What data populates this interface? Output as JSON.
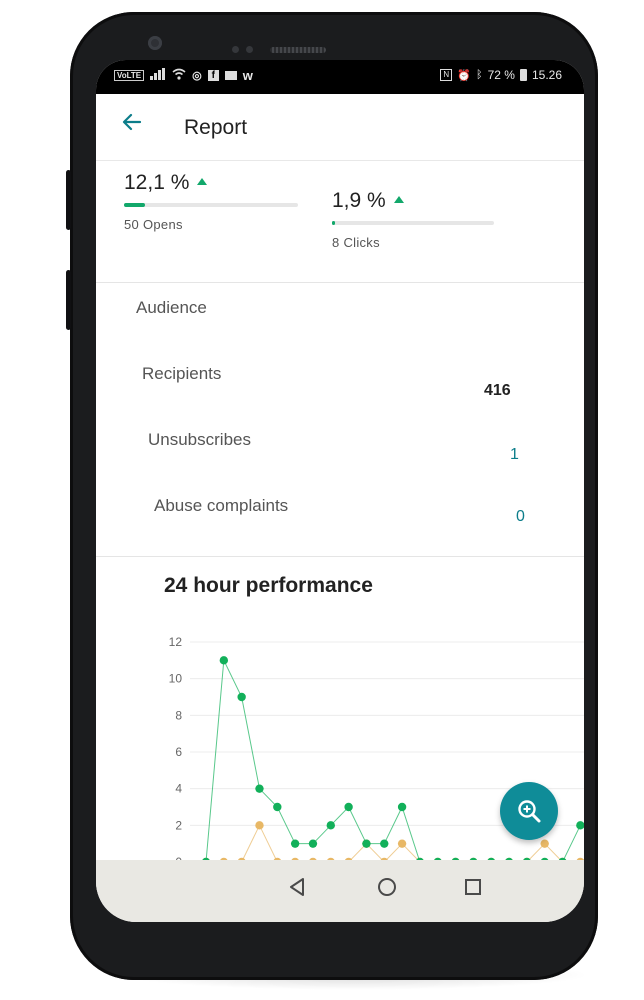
{
  "status_bar": {
    "left_icons": [
      "volte-icon",
      "signal-icon",
      "wifi-icon",
      "camera-notif-icon",
      "facebook-icon",
      "mail-icon",
      "w-icon"
    ],
    "volte": "VoLTE",
    "battery": "72 %",
    "time": "15.26"
  },
  "app_bar": {
    "title": "Report",
    "back_icon": "arrow-left-icon"
  },
  "stats": [
    {
      "value": "12,1 %",
      "trend": "up",
      "progress": 0.12,
      "label": "50 Opens"
    },
    {
      "value": "1,9 %",
      "trend": "up",
      "progress": 0.02,
      "label": "8 Clicks"
    }
  ],
  "audience": {
    "heading": "Audience",
    "rows": [
      {
        "label": "Recipients",
        "value": "416"
      },
      {
        "label": "Unsubscribes",
        "value": "1"
      },
      {
        "label": "Abuse complaints",
        "value": "0"
      }
    ]
  },
  "performance": {
    "title": "24 hour performance"
  },
  "colors": {
    "accent": "#0f8c98",
    "opens_series": "#12b05a",
    "clicks_series": "#e8b866",
    "trend_up": "#12a86b"
  },
  "chart_data": {
    "type": "line",
    "title": "24 hour performance",
    "ylim": [
      0,
      12
    ],
    "yticks": [
      "0",
      "2",
      "4",
      "6",
      "8",
      "10",
      "12"
    ],
    "grid": true,
    "x": [
      0,
      1,
      2,
      3,
      4,
      5,
      6,
      7,
      8,
      9,
      10,
      11,
      12,
      13,
      14,
      15,
      16,
      17,
      18,
      19,
      20,
      21,
      22,
      23
    ],
    "series": [
      {
        "color": "#12b05a",
        "values": [
          0,
          11,
          9,
          4,
          3,
          1,
          1,
          2,
          3,
          1,
          1,
          3,
          0,
          0,
          0,
          0,
          0,
          0,
          0,
          0,
          0,
          2,
          2,
          0
        ]
      },
      {
        "color": "#e8b866",
        "values": [
          0,
          0,
          0,
          2,
          0,
          0,
          0,
          0,
          0,
          1,
          0,
          1,
          0,
          0,
          0,
          0,
          0,
          0,
          0,
          1,
          0,
          0,
          0,
          0
        ]
      }
    ]
  },
  "fab": {
    "icon": "zoom-in-icon"
  },
  "nav": {
    "icons": [
      "back-triangle-icon",
      "home-circle-icon",
      "recents-square-icon"
    ]
  }
}
